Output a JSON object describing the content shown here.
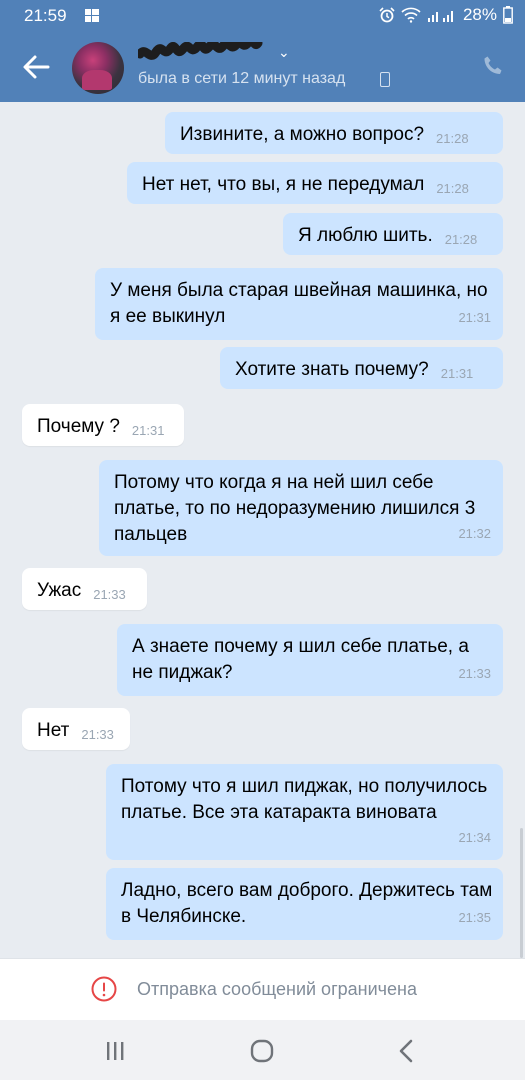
{
  "status_bar": {
    "time": "21:59",
    "battery": "28%"
  },
  "header": {
    "contact_name": "",
    "last_seen": "была в сети 12 минут назад"
  },
  "messages": [
    {
      "dir": "out",
      "text": "Извините, а можно вопрос?",
      "time": "21:28"
    },
    {
      "dir": "out",
      "text": "Нет нет, что вы, я не передумал",
      "time": "21:28"
    },
    {
      "dir": "out",
      "text": "Я люблю шить.",
      "time": "21:28"
    },
    {
      "dir": "out",
      "text": "У меня была старая швейная машинка, но я ее выкинул",
      "time": "21:31"
    },
    {
      "dir": "out",
      "text": "Хотите знать почему?",
      "time": "21:31"
    },
    {
      "dir": "in",
      "text": "Почему ?",
      "time": "21:31"
    },
    {
      "dir": "out",
      "text": "Потому что когда я на ней шил себе платье, то по недоразумению лишился 3 пальцев",
      "time": "21:32"
    },
    {
      "dir": "in",
      "text": "Ужас",
      "time": "21:33"
    },
    {
      "dir": "out",
      "text": "А знаете почему я шил себе платье, а не пиджак?",
      "time": "21:33"
    },
    {
      "dir": "in",
      "text": "Нет",
      "time": "21:33"
    },
    {
      "dir": "out",
      "text": "Потому что я шил пиджак, но получилось платье. Все эта катаракта виновата",
      "time": "21:34"
    },
    {
      "dir": "out",
      "text": "Ладно, всего вам доброго. Держитесь там в Челябинске.",
      "time": "21:35"
    }
  ],
  "restricted_notice": "Отправка сообщений ограничена",
  "icons": {
    "back": "arrow-left-icon",
    "call": "phone-icon",
    "warning": "exclamation-circle-icon",
    "nav": [
      "recents-icon",
      "home-icon",
      "back-icon"
    ]
  },
  "colors": {
    "header": "#5181b8",
    "outgoing_bubble": "#cce4ff",
    "incoming_bubble": "#ffffff",
    "background": "#e8ecf1",
    "warning": "#e64646"
  }
}
